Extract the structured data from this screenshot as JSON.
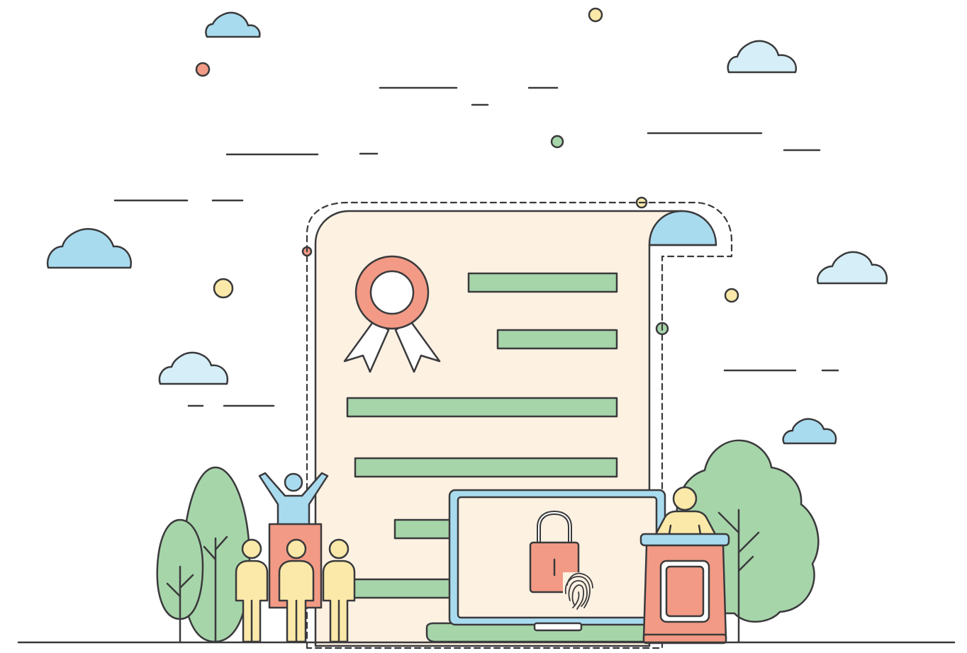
{
  "illustration": {
    "subject": "certificate-scroll-with-voting-scene",
    "colors": {
      "outline": "#3a3a3c",
      "paper": "#fdf1e2",
      "green": "#a7d5aa",
      "coral": "#f29a85",
      "sky": "#a9dbef",
      "sky_light": "#d6eef7",
      "yellow": "#fbe9a9",
      "white": "#ffffff"
    },
    "icons": [
      "cloud-icon",
      "award-ribbon-icon",
      "padlock-icon",
      "fingerprint-icon",
      "person-icon",
      "podium-icon",
      "tree-icon"
    ]
  }
}
